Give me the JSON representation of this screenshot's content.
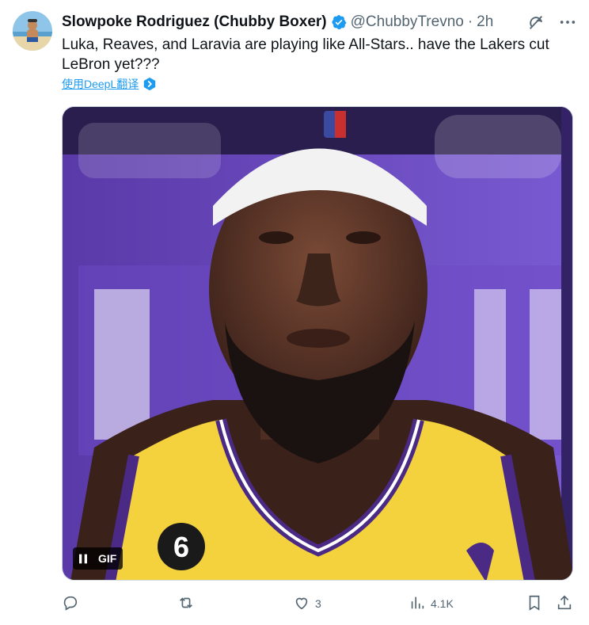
{
  "author": {
    "display_name": "Slowpoke Rodriguez (Chubby Boxer)",
    "handle": "@ChubbyTrevno",
    "separator": "·",
    "time": "2h",
    "verified": true
  },
  "header_icons": {
    "grok": "grok-icon",
    "more": "more-icon"
  },
  "tweet": {
    "text": "Luka, Reaves,  and Laravia are playing like All-Stars.. have the Lakers cut LeBron yet???"
  },
  "translate": {
    "label": "使用DeepL翻译",
    "icon": "deepl-icon"
  },
  "media": {
    "type": "gif",
    "badge_label": "GIF",
    "control_icon": "pause-icon"
  },
  "actions": {
    "reply": {
      "icon": "reply-icon",
      "count": ""
    },
    "retweet": {
      "icon": "retweet-icon",
      "count": ""
    },
    "like": {
      "icon": "heart-icon",
      "count": "3"
    },
    "views": {
      "icon": "views-icon",
      "count": "4.1K"
    },
    "bookmark": {
      "icon": "bookmark-icon",
      "count": ""
    },
    "share": {
      "icon": "share-icon",
      "count": ""
    }
  },
  "colors": {
    "accent": "#1d9bf0",
    "text_primary": "#0f1419",
    "text_secondary": "#536471",
    "lakers_purple": "#552583",
    "lakers_gold": "#fdb927"
  }
}
